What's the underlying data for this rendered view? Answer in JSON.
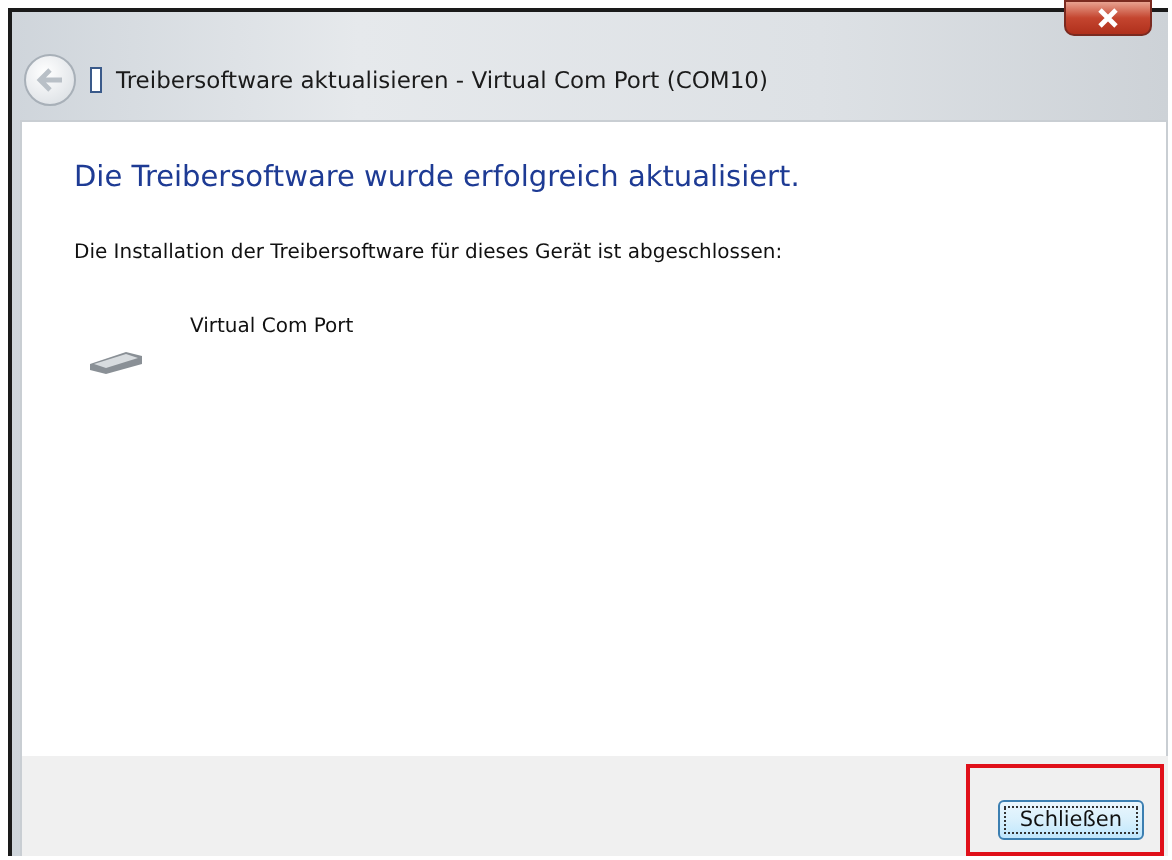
{
  "window": {
    "title": "Treibersoftware aktualisieren - Virtual Com Port (COM10)"
  },
  "heading": "Die Treibersoftware wurde erfolgreich aktualisiert.",
  "message": "Die Installation der Treibersoftware für dieses Gerät ist abgeschlossen:",
  "devices": [
    {
      "name": "Virtual Com Port"
    }
  ],
  "buttons": [
    {
      "label": "Schließen",
      "highlighted": true
    }
  ]
}
